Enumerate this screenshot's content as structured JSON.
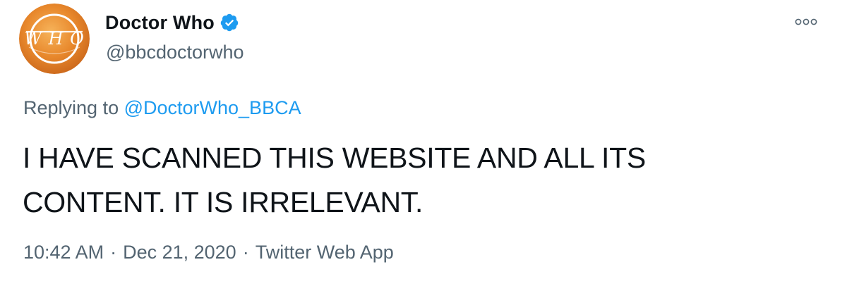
{
  "tweet": {
    "avatar_logo_text": "WHO",
    "display_name": "Doctor Who",
    "verified": true,
    "handle": "@bbcdoctorwho",
    "more_icon": "more-horizontal-icon",
    "reply_prefix": "Replying to ",
    "reply_mention": "@DoctorWho_BBCA",
    "text": "I HAVE SCANNED THIS WEBSITE AND ALL ITS CONTENT. IT IS IRRELEVANT.",
    "time": "10:42 AM",
    "separator": "·",
    "date": "Dec 21, 2020",
    "source": "Twitter Web App"
  },
  "colors": {
    "link": "#1d9bf0",
    "secondary_text": "#536471",
    "primary_text": "#0f1419",
    "avatar_orange": "#e8882c",
    "verified_blue": "#1d9bf0"
  }
}
